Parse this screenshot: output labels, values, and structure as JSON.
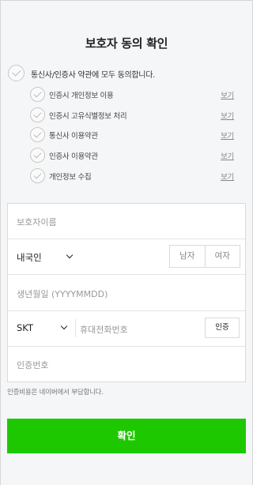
{
  "title": "보호자 동의 확인",
  "agree_all": {
    "label": "통신사/인증사 약관에 모두 동의합니다."
  },
  "terms": [
    {
      "label": "인증시 개인정보 이용",
      "view": "보기"
    },
    {
      "label": "인증시 고유식별정보 처리",
      "view": "보기"
    },
    {
      "label": "통신사 이용약관",
      "view": "보기"
    },
    {
      "label": "인증사 이용약관",
      "view": "보기"
    },
    {
      "label": "개인정보 수집",
      "view": "보기"
    }
  ],
  "form": {
    "guardian_name_placeholder": "보호자이름",
    "nationality_value": "내국인",
    "gender_male": "남자",
    "gender_female": "여자",
    "birthdate_placeholder": "생년월일 (YYYYMMDD)",
    "carrier_value": "SKT",
    "phone_placeholder": "휴대전화번호",
    "auth_button": "인증",
    "auth_code_placeholder": "인증번호"
  },
  "notice": "인증비용은 네이버에서 부담합니다.",
  "confirm_button": "확인",
  "colors": {
    "accent": "#1ec800"
  }
}
